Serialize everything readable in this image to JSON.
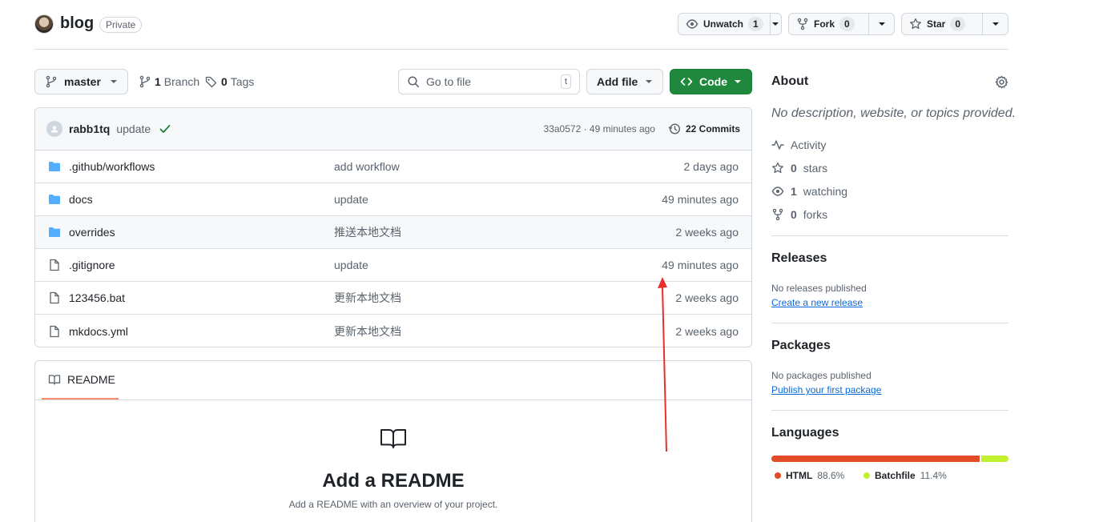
{
  "repo": {
    "name": "blog",
    "visibility": "Private",
    "unwatch_label": "Unwatch",
    "watch_count": "1",
    "fork_label": "Fork",
    "fork_count": "0",
    "star_label": "Star",
    "star_count": "0"
  },
  "toolbar": {
    "branch": "master",
    "branches_count": "1",
    "branches_label": "Branch",
    "tags_count": "0",
    "tags_label": "Tags",
    "search_placeholder": "Go to file",
    "search_shortcut": "t",
    "add_file_label": "Add file",
    "code_label": "Code"
  },
  "latest_commit": {
    "user": "rabb1tq",
    "message": "update",
    "hash_time": "33a0572 · 49 minutes ago",
    "commits_label": "22 Commits"
  },
  "files": [
    {
      "name": ".github/workflows",
      "type": "dir",
      "message": "add workflow",
      "date": "2 days ago"
    },
    {
      "name": "docs",
      "type": "dir",
      "message": "update",
      "date": "49 minutes ago"
    },
    {
      "name": "overrides",
      "type": "dir",
      "message": "推送本地文档",
      "date": "2 weeks ago"
    },
    {
      "name": ".gitignore",
      "type": "file",
      "message": "update",
      "date": "49 minutes ago"
    },
    {
      "name": "123456.bat",
      "type": "file",
      "message": "更新本地文档",
      "date": "2 weeks ago"
    },
    {
      "name": "mkdocs.yml",
      "type": "file",
      "message": "更新本地文档",
      "date": "2 weeks ago"
    }
  ],
  "readme": {
    "tab_label": "README",
    "title": "Add a README",
    "subtitle": "Add a README with an overview of your project."
  },
  "about": {
    "heading": "About",
    "description": "No description, website, or topics provided.",
    "activity_label": "Activity",
    "stars_count": "0",
    "stars_label": "stars",
    "watching_count": "1",
    "watching_label": "watching",
    "forks_count": "0",
    "forks_label": "forks"
  },
  "releases": {
    "heading": "Releases",
    "empty_text": "No releases published",
    "link": "Create a new release"
  },
  "packages": {
    "heading": "Packages",
    "empty_text": "No packages published",
    "link": "Publish your first package"
  },
  "languages": {
    "heading": "Languages",
    "items": [
      {
        "name": "HTML",
        "percent": "88.6%",
        "value": 88.6,
        "color": "#e34c26"
      },
      {
        "name": "Batchfile",
        "percent": "11.4%",
        "value": 11.4,
        "color": "#c1f12e"
      }
    ]
  },
  "colors": {
    "primary_button": "#1f883d",
    "link": "#0969da",
    "folder": "#54aeff",
    "annotation_arrow": "#e8302a"
  }
}
